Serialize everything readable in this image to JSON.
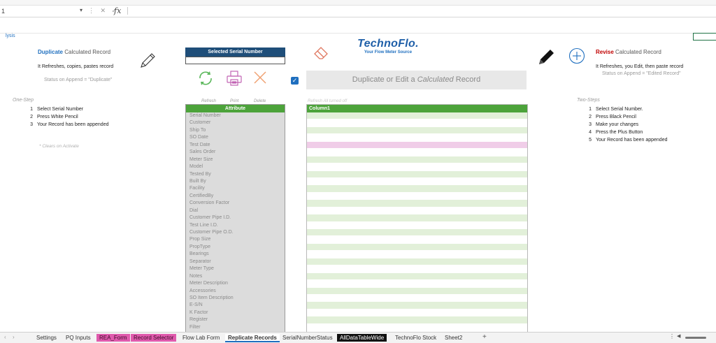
{
  "formula_bar": {
    "name_box": "1",
    "fx": "fx",
    "ops": "⋮ ✕ ✓"
  },
  "row_label": "lysis",
  "duplicate": {
    "title_bold": "Duplicate",
    "title_rest": "Calculated Record",
    "desc": "It Refreshes, copies, pastes record",
    "status": "Status on Append  =  \"Duplicate\""
  },
  "one_step": {
    "label": "One-Step",
    "steps": [
      {
        "n": "1",
        "text": "Select Serial Number"
      },
      {
        "n": "2",
        "text": "Press White Pencil"
      },
      {
        "n": "3",
        "text": "Your Record has been appended"
      }
    ],
    "note": "* Clears on Activate"
  },
  "serial": {
    "header": "Selected Serial Number"
  },
  "actions": {
    "refresh": "Refresh",
    "print": "Print",
    "delete": "Delete"
  },
  "brand": {
    "name": "TechnoFlo.",
    "tagline": "Your Flow Meter Source"
  },
  "dup_edit_button": {
    "pre": "Duplicate or Edit a ",
    "italic": "Calculated",
    "post": " Record"
  },
  "refresh_note": "Refresh All turned off",
  "attribute_table": {
    "header": "Attribute",
    "rows": [
      "Serial Number",
      "Customer",
      "Ship To",
      "SO Date",
      "Test Date",
      "Sales Order",
      "Meter Size",
      "Model",
      "Tested By",
      "Built By",
      "Facility",
      "CertifiedBy",
      "Conversion Factor",
      "Dial",
      "Customer Pipe I.D.",
      "Test Line I.D.",
      "Customer Pipe O.D.",
      "Prop Size",
      "PropType",
      "Bearings",
      "Separator",
      "Meter Type",
      "Notes",
      "Meter Description",
      "Accessories",
      "SO Item Description",
      "E-S/N",
      "K Factor",
      "Register",
      "Filter"
    ]
  },
  "column_table": {
    "header": "Column1",
    "row_colors": [
      "green",
      "white",
      "green",
      "white",
      "pink",
      "white",
      "green",
      "white",
      "green",
      "white",
      "green",
      "white",
      "green",
      "white",
      "green",
      "white",
      "green",
      "white",
      "green",
      "white",
      "green",
      "white",
      "green",
      "white",
      "green",
      "white",
      "green",
      "white",
      "green",
      "white"
    ]
  },
  "revise": {
    "title_bold": "Revise",
    "title_rest": "Calculated Record",
    "desc": "It Refreshes, you Edit, then paste record",
    "status": "Status on Append  =  \"Edited Record\""
  },
  "two_steps": {
    "label": "Two-Steps",
    "steps": [
      {
        "n": "1",
        "text": "Select Serial Number."
      },
      {
        "n": "2",
        "text": "Press Black Pencil"
      },
      {
        "n": "3",
        "text": "Make your changes"
      },
      {
        "n": "4",
        "text": "Press the Plus Button"
      },
      {
        "n": "5",
        "text": "Your Record has been appended"
      }
    ]
  },
  "tabs": [
    {
      "label": "Settings",
      "style": "normal"
    },
    {
      "label": "PQ Inputs",
      "style": "normal"
    },
    {
      "label": "REA_Form",
      "style": "pink"
    },
    {
      "label": "Record Selector",
      "style": "pink"
    },
    {
      "label": "Flow Lab Form",
      "style": "normal"
    },
    {
      "label": "Replicate Records",
      "style": "active"
    },
    {
      "label": "SerialNumberStatus",
      "style": "normal"
    },
    {
      "label": "AllDataTableWide",
      "style": "black"
    },
    {
      "label": "TechnoFlo Stock",
      "style": "normal"
    },
    {
      "label": "Sheet2",
      "style": "normal"
    }
  ],
  "add_sheet": "+",
  "colors": {
    "accent_blue": "#1f6fbf",
    "header_green": "#4ca33a",
    "navy": "#1f4e79",
    "revise_red": "#c00000"
  }
}
